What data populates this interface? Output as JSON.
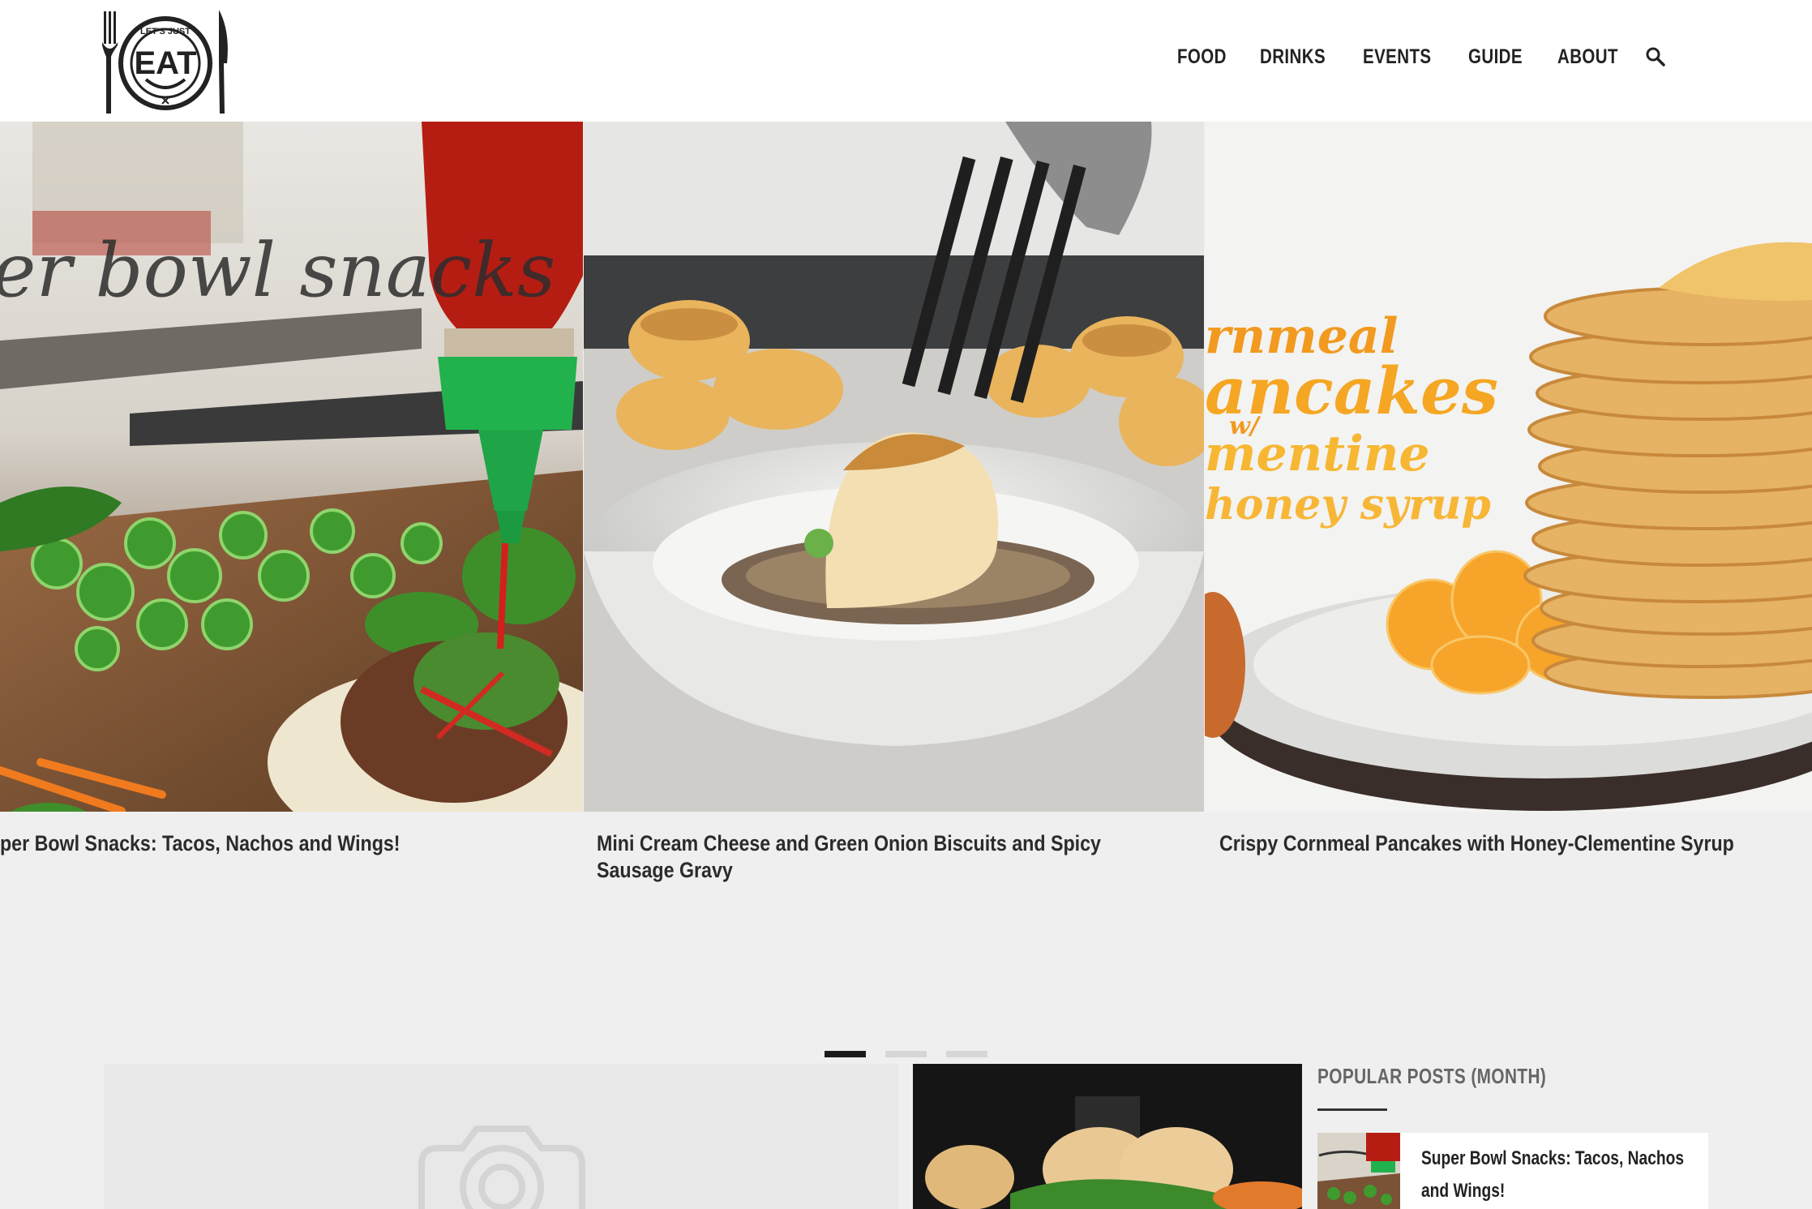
{
  "nav": {
    "items": [
      "FOOD",
      "DRINKS",
      "EVENTS",
      "GUIDE",
      "ABOUT"
    ]
  },
  "logo": {
    "text": "EAT",
    "ring_text": "LET'S JUST"
  },
  "slider": {
    "slides": [
      {
        "caption": "per Bowl Snacks: Tacos, Nachos and Wings!",
        "overlay_text": "er bowl snacks"
      },
      {
        "caption": "Mini Cream Cheese and Green Onion Biscuits and Spicy Sausage Gravy"
      },
      {
        "caption": "Crispy Cornmeal Pancakes with Honey-Clementine Syrup",
        "overlay_lines": [
          "rnmeal",
          "ancakes",
          "w/",
          "mentine",
          "honey syrup"
        ]
      }
    ],
    "active_index": 0
  },
  "sidebar": {
    "popular_title": "POPULAR POSTS (MONTH)",
    "popular_items": [
      {
        "title": "Super Bowl Snacks: Tacos, Nachos and Wings!"
      }
    ]
  },
  "colors": {
    "background": "#efefef",
    "header": "#ffffff",
    "text": "#222222",
    "dot_active": "#1b1b1b",
    "dot_inactive": "#d6d6d6"
  }
}
